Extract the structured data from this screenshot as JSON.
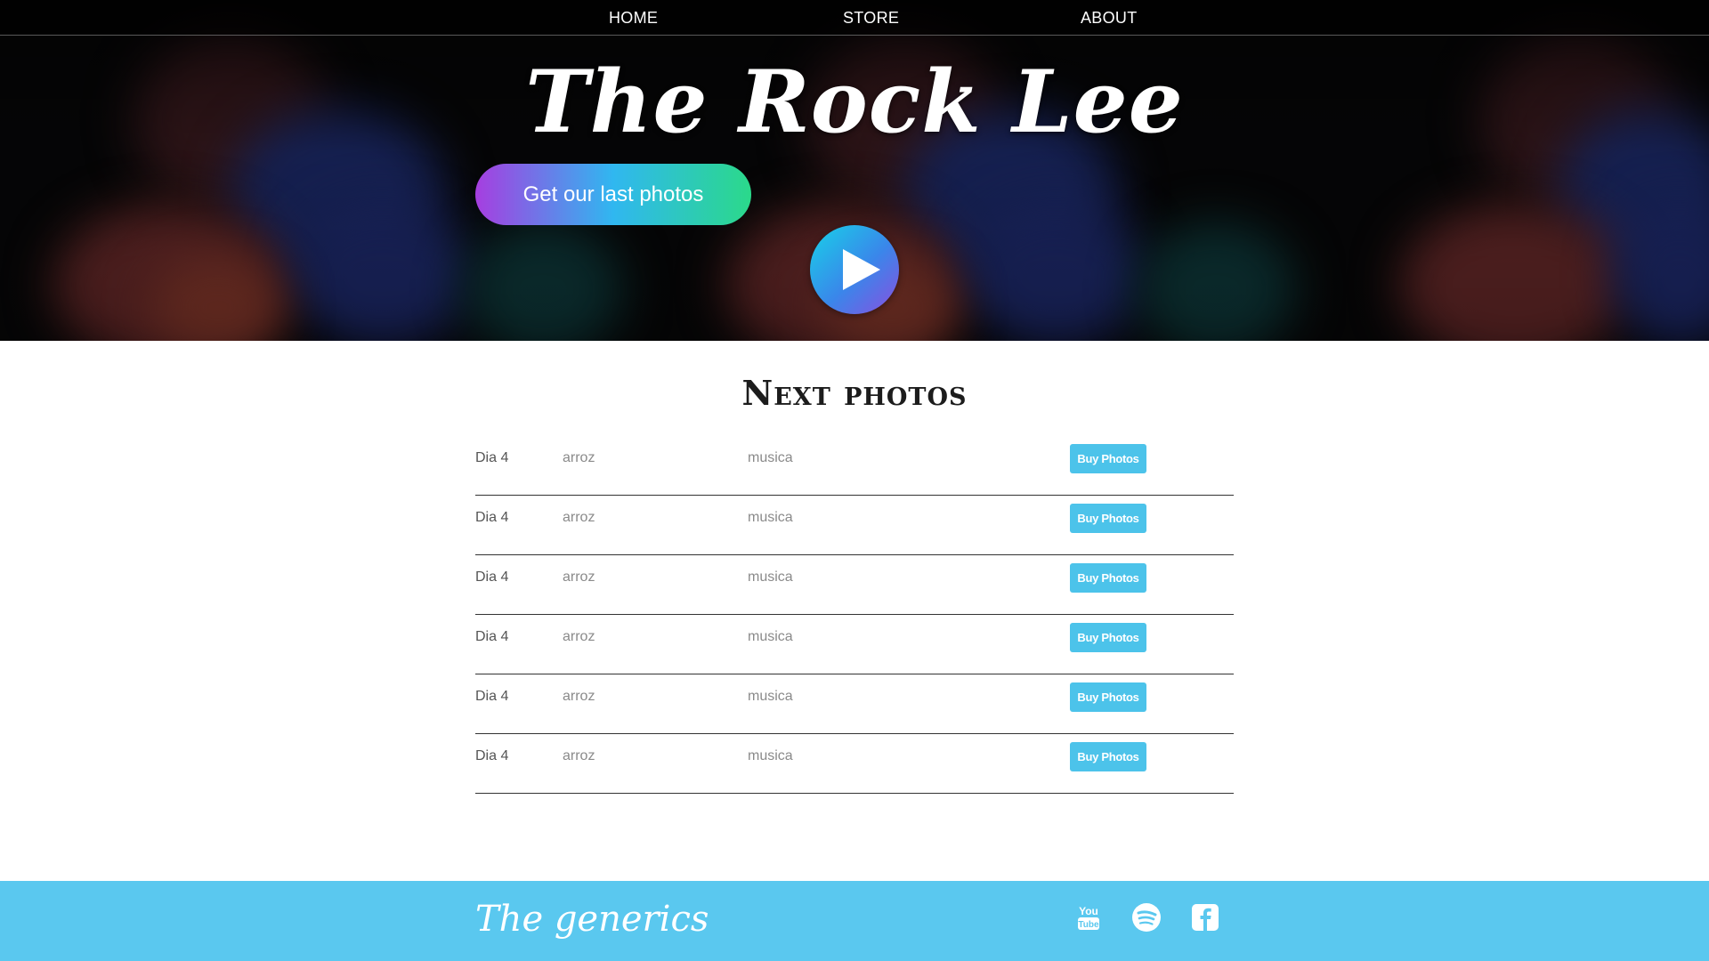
{
  "nav": {
    "items": [
      {
        "label": "HOME"
      },
      {
        "label": "STORE"
      },
      {
        "label": "ABOUT"
      }
    ]
  },
  "hero": {
    "title": "The Rock Lee",
    "cta_label": "Get our last photos",
    "play_icon": "play-icon"
  },
  "main": {
    "title": "Next photos",
    "rows": [
      {
        "day": "Dia 4",
        "food": "arroz",
        "genre": "musica",
        "button": "Buy Photos"
      },
      {
        "day": "Dia 4",
        "food": "arroz",
        "genre": "musica",
        "button": "Buy Photos"
      },
      {
        "day": "Dia 4",
        "food": "arroz",
        "genre": "musica",
        "button": "Buy Photos"
      },
      {
        "day": "Dia 4",
        "food": "arroz",
        "genre": "musica",
        "button": "Buy Photos"
      },
      {
        "day": "Dia 4",
        "food": "arroz",
        "genre": "musica",
        "button": "Buy Photos"
      },
      {
        "day": "Dia 4",
        "food": "arroz",
        "genre": "musica",
        "button": "Buy Photos"
      }
    ]
  },
  "footer": {
    "brand": "The generics",
    "social": [
      "youtube-icon",
      "spotify-icon",
      "facebook-icon"
    ]
  },
  "colors": {
    "accent": "#5ac8ef",
    "button": "#4cc3ea",
    "cta_gradient": [
      "#a63ee0",
      "#30b7f0",
      "#2bd98a"
    ]
  }
}
